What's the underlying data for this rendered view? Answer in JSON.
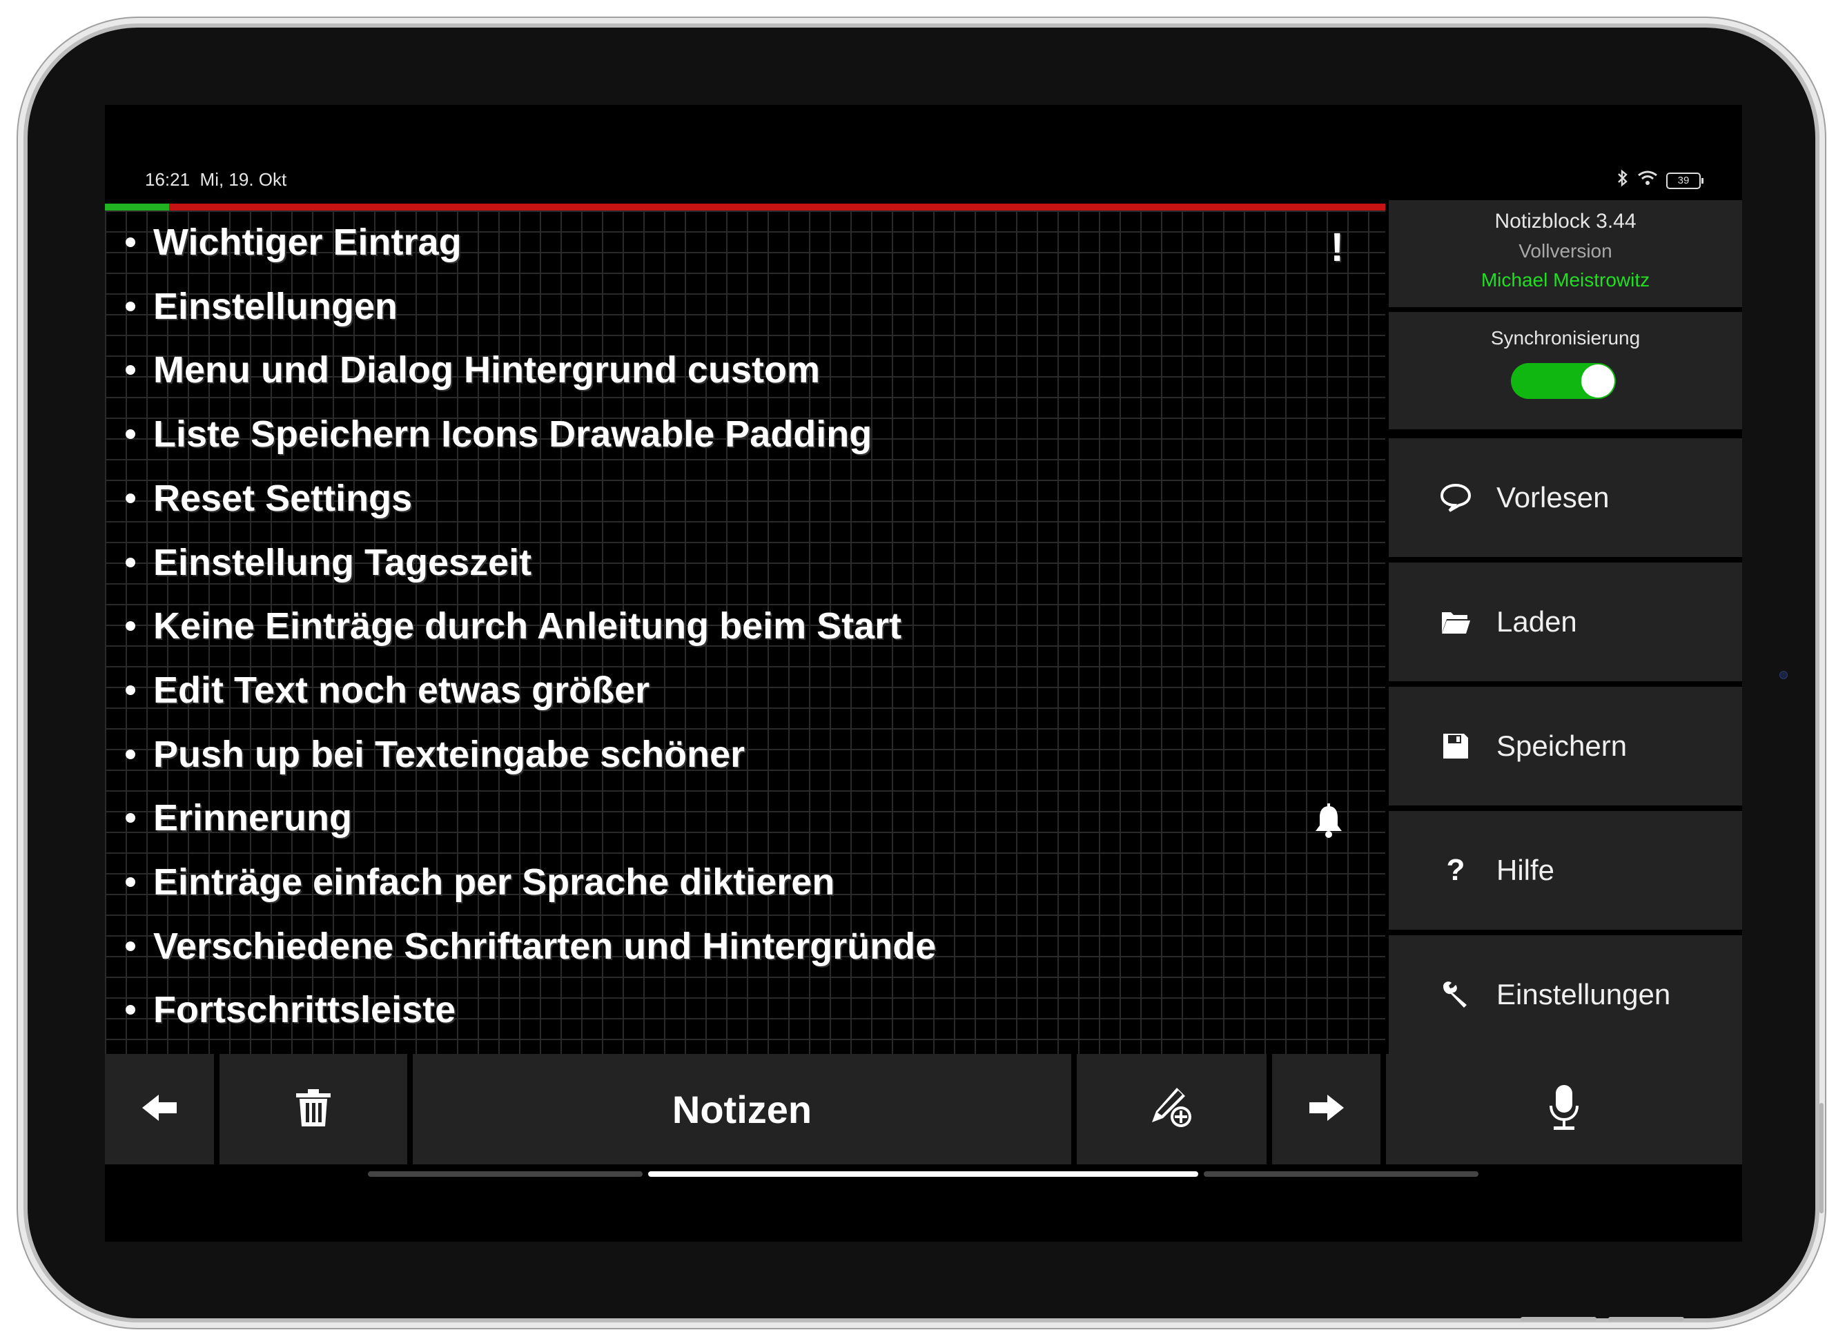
{
  "status": {
    "time": "16:21",
    "date": "Mi, 19. Okt",
    "battery": "39"
  },
  "progress_fraction": 0.05,
  "entries": [
    {
      "text": "Wichtiger Eintrag",
      "marker": "!"
    },
    {
      "text": "Einstellungen"
    },
    {
      "text": "Menu und Dialog Hintergrund custom"
    },
    {
      "text": "Liste Speichern Icons Drawable Padding"
    },
    {
      "text": "Reset Settings"
    },
    {
      "text": "Einstellung Tageszeit"
    },
    {
      "text": "Keine Einträge durch Anleitung beim Start"
    },
    {
      "text": "Edit Text noch etwas größer"
    },
    {
      "text": "Push up bei Texteingabe schöner"
    },
    {
      "text": "Erinnerung",
      "marker_icon": "bell-icon"
    },
    {
      "text": "Einträge einfach per Sprache diktieren"
    },
    {
      "text": "Verschiedene Schriftarten und Hintergründe"
    },
    {
      "text": "Fortschrittsleiste"
    }
  ],
  "sidebar": {
    "app_name": "Notizblock 3.44",
    "edition": "Vollversion",
    "author": "Michael Meistrowitz",
    "sync_label": "Synchronisierung",
    "sync_on": true,
    "menu": [
      {
        "label": "Vorlesen",
        "icon": "speech-bubble-icon"
      },
      {
        "label": "Laden",
        "icon": "folder-open-icon"
      },
      {
        "label": "Speichern",
        "icon": "floppy-disk-icon"
      },
      {
        "label": "Hilfe",
        "icon": "question-icon"
      },
      {
        "label": "Einstellungen",
        "icon": "wrench-icon"
      }
    ]
  },
  "bottombar": {
    "title": "Notizen"
  },
  "colors": {
    "progress_done": "#22b322",
    "progress_rest": "#c51212",
    "toggle_on": "#11b711",
    "author": "#22dd22"
  }
}
